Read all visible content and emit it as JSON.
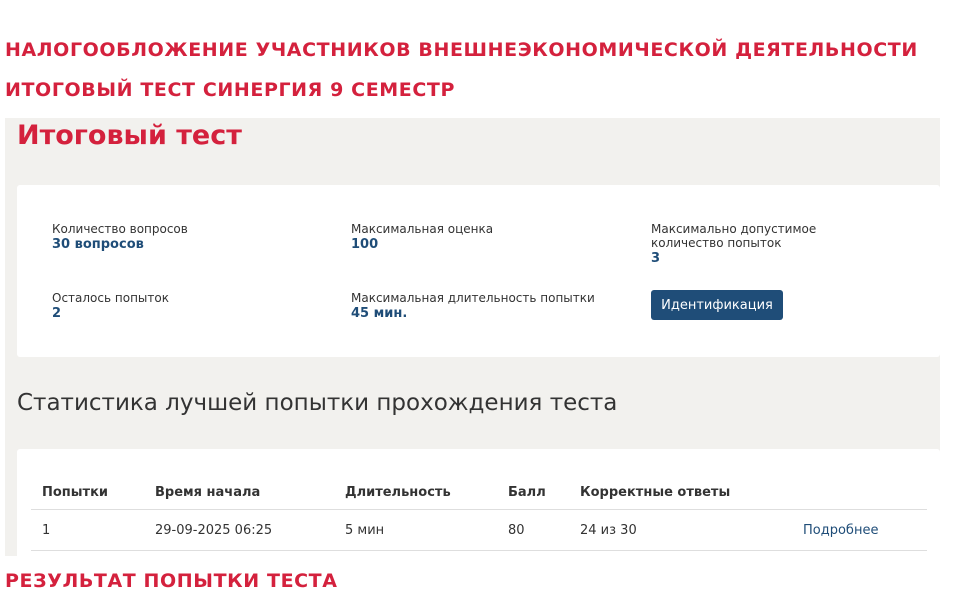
{
  "headings": {
    "line1": "НАЛОГООБЛОЖЕНИЕ УЧАСТНИКОВ ВНЕШНЕЭКОНОМИЧЕСКОЙ ДЕЯТЕЛЬНОСТИ",
    "line2": "ИТОГОВЫЙ ТЕСТ СИНЕРГИЯ 9 СЕМЕСТР",
    "line3": "РЕЗУЛЬТАТ ПОПЫТКИ ТЕСТА"
  },
  "test": {
    "title": "Итоговый тест",
    "info": {
      "questions_label": "Количество вопросов",
      "questions_value": "30 вопросов",
      "max_score_label": "Максимальная оценка",
      "max_score_value": "100",
      "max_attempts_label": "Максимально допустимое количество попыток",
      "max_attempts_value": "3",
      "attempts_left_label": "Осталось попыток",
      "attempts_left_value": "2",
      "max_duration_label": "Максимальная длительность попытки",
      "max_duration_value": "45 мин.",
      "identify_button": "Идентификация"
    }
  },
  "stats": {
    "title": "Статистика лучшей попытки прохождения теста",
    "columns": [
      "Попытки",
      "Время начала",
      "Длительность",
      "Балл",
      "Корректные ответы"
    ],
    "rows": [
      {
        "attempt": "1",
        "start_time": "29-09-2025 06:25",
        "duration": "5 мин",
        "score": "80",
        "correct": "24 из 30",
        "details_link": "Подробнее"
      }
    ]
  },
  "colors": {
    "accent_red": "#d4213d",
    "brand_blue": "#1f4d78",
    "panel_bg": "#f2f1ee"
  }
}
